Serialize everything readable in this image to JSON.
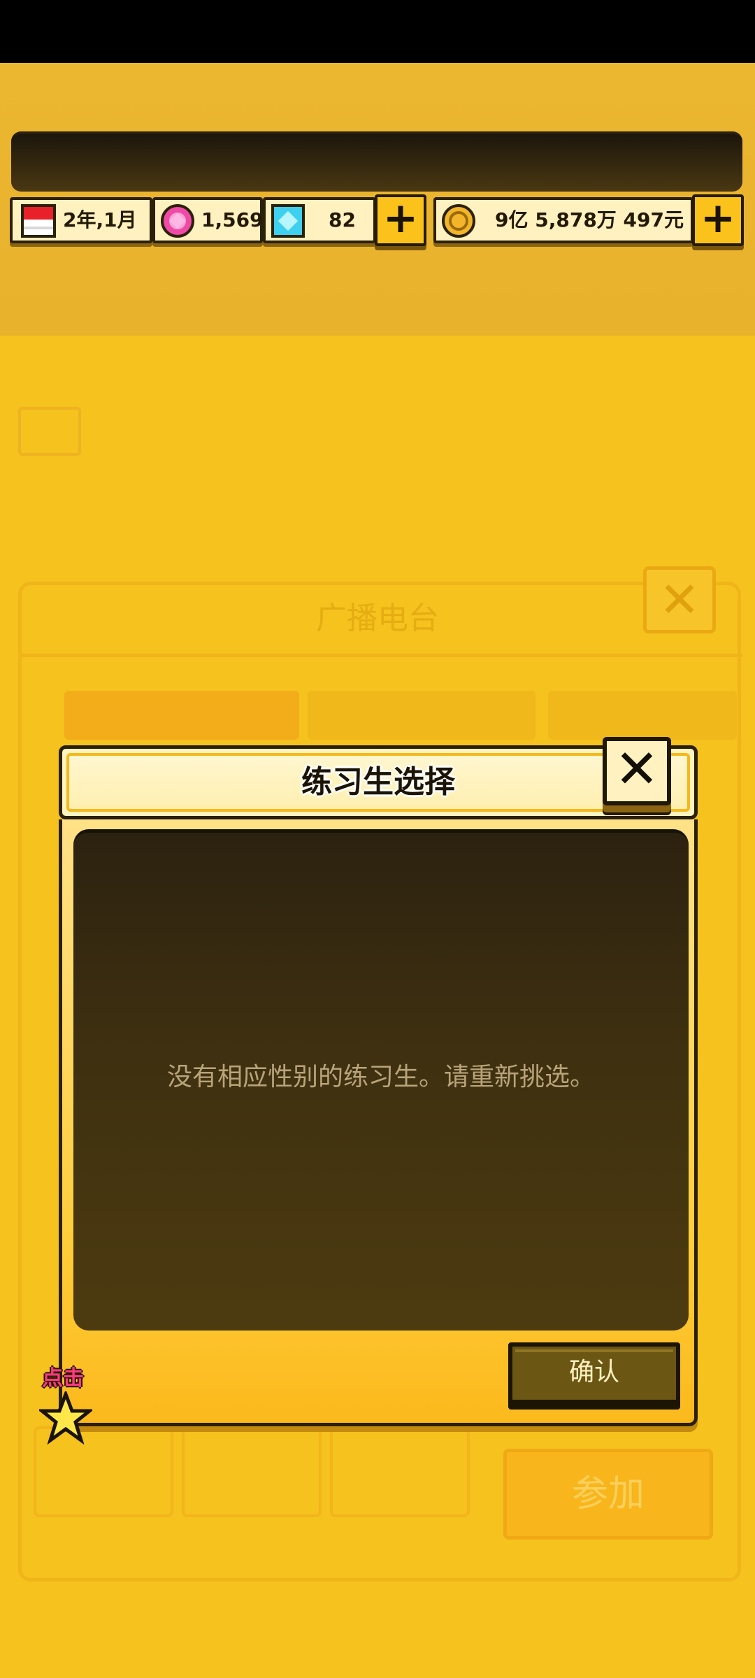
{
  "resources": {
    "date": "2年,1月",
    "gems": "1,569",
    "diamonds": "82",
    "money": "9亿 5,878万 497元"
  },
  "background": {
    "radio_label": "广播电台",
    "join_label": "参加"
  },
  "dialog": {
    "title": "练习生选择",
    "message": "没有相应性别的练习生。请重新挑选。",
    "confirm_label": "确认"
  },
  "hint": {
    "tap_label": "点击"
  },
  "colors": {
    "accent_yellow": "#fcc21c",
    "panel_dark": "#3d2f10",
    "hint_pink": "#ff3a80"
  }
}
